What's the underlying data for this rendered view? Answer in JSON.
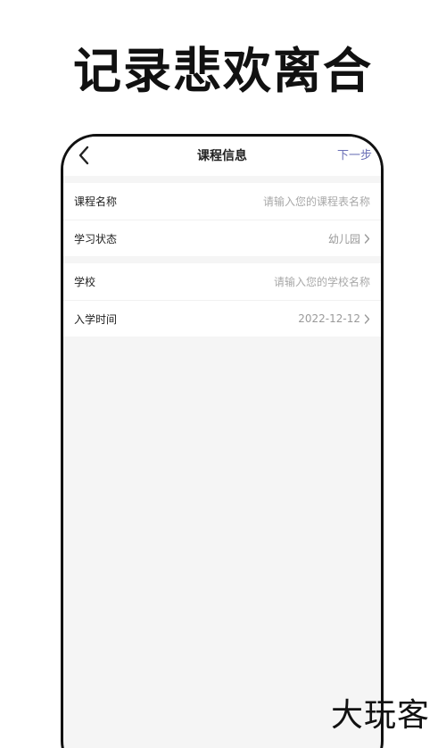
{
  "headline": "记录悲欢离合",
  "navbar": {
    "title": "课程信息",
    "next_label": "下一步"
  },
  "form": {
    "course_name": {
      "label": "课程名称",
      "placeholder": "请输入您的课程表名称"
    },
    "study_status": {
      "label": "学习状态",
      "value": "幼儿园"
    },
    "school": {
      "label": "学校",
      "placeholder": "请输入您的学校名称"
    },
    "enroll_date": {
      "label": "入学时间",
      "value": "2022-12-12"
    }
  },
  "watermark": "大玩客",
  "icons": {
    "back": "chevron-left-icon",
    "row_arrow": "chevron-right-icon"
  },
  "colors": {
    "accent": "#6a6fb6",
    "background": "#f5f5f5",
    "text": "#222222",
    "muted": "#9a9a9a"
  }
}
